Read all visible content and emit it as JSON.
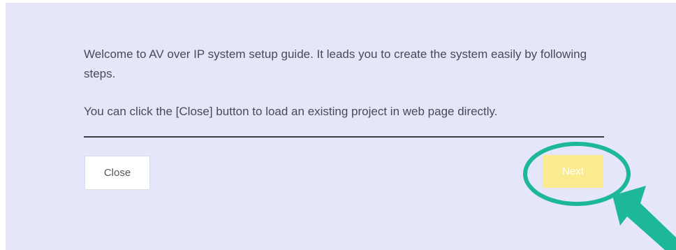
{
  "dialog": {
    "intro_text": "Welcome to AV over IP system setup guide. It leads you to create the system easily by following steps.",
    "close_hint_text": "You can click the [Close] button to load an existing project in web page directly."
  },
  "buttons": {
    "close_label": "Close",
    "next_label": "Next"
  },
  "annotation": {
    "color": "#1db89a",
    "icons": [
      "highlight-circle-icon",
      "pointer-arrow-icon"
    ]
  },
  "colors": {
    "background": "#e6e6fa",
    "next_button": "#fbeb8f",
    "text": "#4a4a55"
  }
}
